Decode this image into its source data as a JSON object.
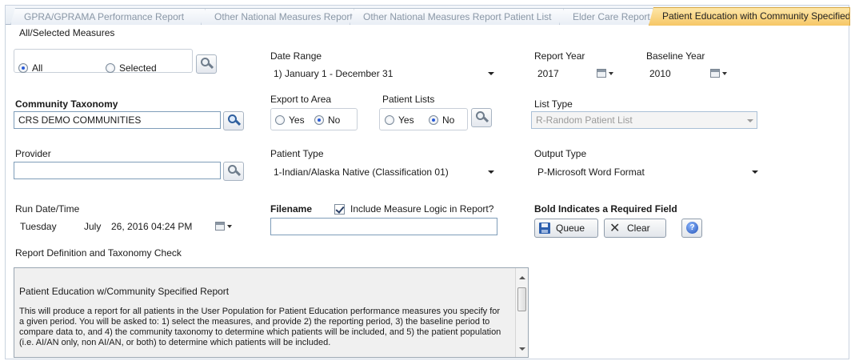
{
  "tabs": [
    {
      "label": "GPRA/GPRAMA Performance Report",
      "active": false
    },
    {
      "label": "Other National Measures Report",
      "active": false
    },
    {
      "label": "Other National Measures Report Patient List",
      "active": false
    },
    {
      "label": "Elder Care Report",
      "active": false
    },
    {
      "label": "Patient Education with Community Specified",
      "active": true
    }
  ],
  "measures": {
    "label": "All/Selected Measures",
    "all_label": "All",
    "selected_label": "Selected",
    "selected_value": "All"
  },
  "date_range": {
    "label": "Date Range",
    "value": "1) January 1 - December 31"
  },
  "report_year": {
    "label": "Report Year",
    "value": "2017"
  },
  "baseline_year": {
    "label": "Baseline Year",
    "value": "2010"
  },
  "community_taxonomy": {
    "label": "Community Taxonomy",
    "value": "CRS DEMO COMMUNITIES"
  },
  "export_to_area": {
    "label": "Export to Area",
    "yes_label": "Yes",
    "no_label": "No",
    "selected_value": "No"
  },
  "patient_lists": {
    "label": "Patient Lists",
    "yes_label": "Yes",
    "no_label": "No",
    "selected_value": "No"
  },
  "list_type": {
    "label": "List Type",
    "value": "R-Random Patient List"
  },
  "provider": {
    "label": "Provider",
    "value": ""
  },
  "patient_type": {
    "label": "Patient Type",
    "value": "1-Indian/Alaska Native (Classification 01)"
  },
  "output_type": {
    "label": "Output Type",
    "value": "P-Microsoft Word Format"
  },
  "run_datetime": {
    "label": "Run Date/Time",
    "day": "Tuesday",
    "month": "July",
    "date_time": "26, 2016 04:24 PM"
  },
  "filename": {
    "label": "Filename",
    "value": ""
  },
  "include_logic": {
    "label": "Include Measure Logic in Report?",
    "checked": true
  },
  "required_note": "Bold Indicates a Required Field",
  "buttons": {
    "queue": "Queue",
    "clear": "Clear",
    "help": "?"
  },
  "definition": {
    "label": "Report Definition and Taxonomy Check",
    "title": "Patient Education w/Community Specified Report",
    "body": "This will produce a report for all patients in the User Population for Patient Education performance measures you specify for a given period.  You will be asked to:  1) select the measures, and provide 2) the reporting period, 3) the baseline period to compare data to, and 4) the community taxonomy to determine which patients will be included, and 5) the patient population (i.e. AI/AN only, non AI/AN, or both) to determine which patients will be included."
  }
}
